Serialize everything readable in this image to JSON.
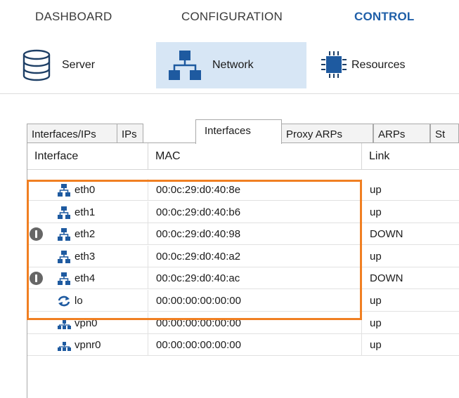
{
  "nav": {
    "tabs": [
      {
        "label": "DASHBOARD",
        "active": false
      },
      {
        "label": "CONFIGURATION",
        "active": false
      },
      {
        "label": "CONTROL",
        "active": true
      }
    ]
  },
  "toolbar": {
    "buttons": [
      {
        "label": "Server",
        "icon": "database-icon",
        "active": false
      },
      {
        "label": "Network",
        "icon": "network-icon",
        "active": true
      },
      {
        "label": "Resources",
        "icon": "chip-icon",
        "active": false
      }
    ]
  },
  "tabs": [
    {
      "label": "Interfaces/IPs",
      "selected": false
    },
    {
      "label": "IPs",
      "selected": false
    },
    {
      "label": "Interfaces",
      "selected": true
    },
    {
      "label": "Proxy ARPs",
      "selected": false
    },
    {
      "label": "ARPs",
      "selected": false
    },
    {
      "label": "St",
      "selected": false
    }
  ],
  "table": {
    "columns": [
      "Interface",
      "MAC",
      "Link"
    ],
    "rows": [
      {
        "interface": "eth0",
        "mac": "00:0c:29:d0:40:8e",
        "link": "up",
        "icon": "network-icon",
        "warning": false
      },
      {
        "interface": "eth1",
        "mac": "00:0c:29:d0:40:b6",
        "link": "up",
        "icon": "network-icon",
        "warning": false
      },
      {
        "interface": "eth2",
        "mac": "00:0c:29:d0:40:98",
        "link": "DOWN",
        "icon": "network-icon",
        "warning": true
      },
      {
        "interface": "eth3",
        "mac": "00:0c:29:d0:40:a2",
        "link": "up",
        "icon": "network-icon",
        "warning": false
      },
      {
        "interface": "eth4",
        "mac": "00:0c:29:d0:40:ac",
        "link": "DOWN",
        "icon": "network-icon",
        "warning": true
      },
      {
        "interface": "lo",
        "mac": "00:00:00:00:00:00",
        "link": "up",
        "icon": "loopback-icon",
        "warning": false
      },
      {
        "interface": "vpn0",
        "mac": "00:00:00:00:00:00",
        "link": "up",
        "icon": "vpn-icon",
        "warning": false
      },
      {
        "interface": "vpnr0",
        "mac": "00:00:00:00:00:00",
        "link": "up",
        "icon": "vpn-icon",
        "warning": false
      }
    ]
  },
  "colors": {
    "accent": "#1f5fa8",
    "active_toolbar_bg": "#d7e6f5",
    "highlight_border": "#f07f22",
    "icon_blue": "#1e5aa0",
    "warning_gray": "#666666"
  }
}
